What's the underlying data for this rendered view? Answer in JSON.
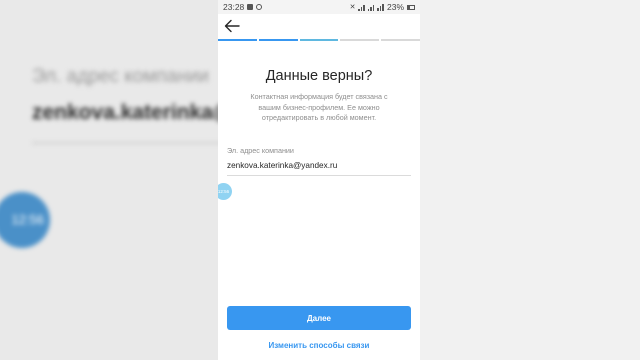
{
  "background": {
    "email_label": "Эл. адрес компании",
    "email_value": "zenkova.katerinka@yandex.ru",
    "bubble_text": "12:56"
  },
  "status_bar": {
    "time": "23:28",
    "battery": "23%"
  },
  "progress_steps": [
    "done",
    "done",
    "done2",
    "todo",
    "todo"
  ],
  "header": {
    "title": "Данные верны?",
    "subtitle": "Контактная информация будет связана с вашим бизнес-профилем. Ее можно отредактировать в любой момент."
  },
  "email_field": {
    "label": "Эл. адрес компании",
    "value": "zenkova.katerinka@yandex.ru"
  },
  "bubble_text": "12:56",
  "actions": {
    "next_label": "Далее",
    "change_contacts_label": "Изменить способы связи"
  },
  "colors": {
    "accent": "#3897f0",
    "text": "#262626",
    "muted": "#8e8e8e"
  },
  "icons": {
    "back": "arrow-left-icon"
  }
}
